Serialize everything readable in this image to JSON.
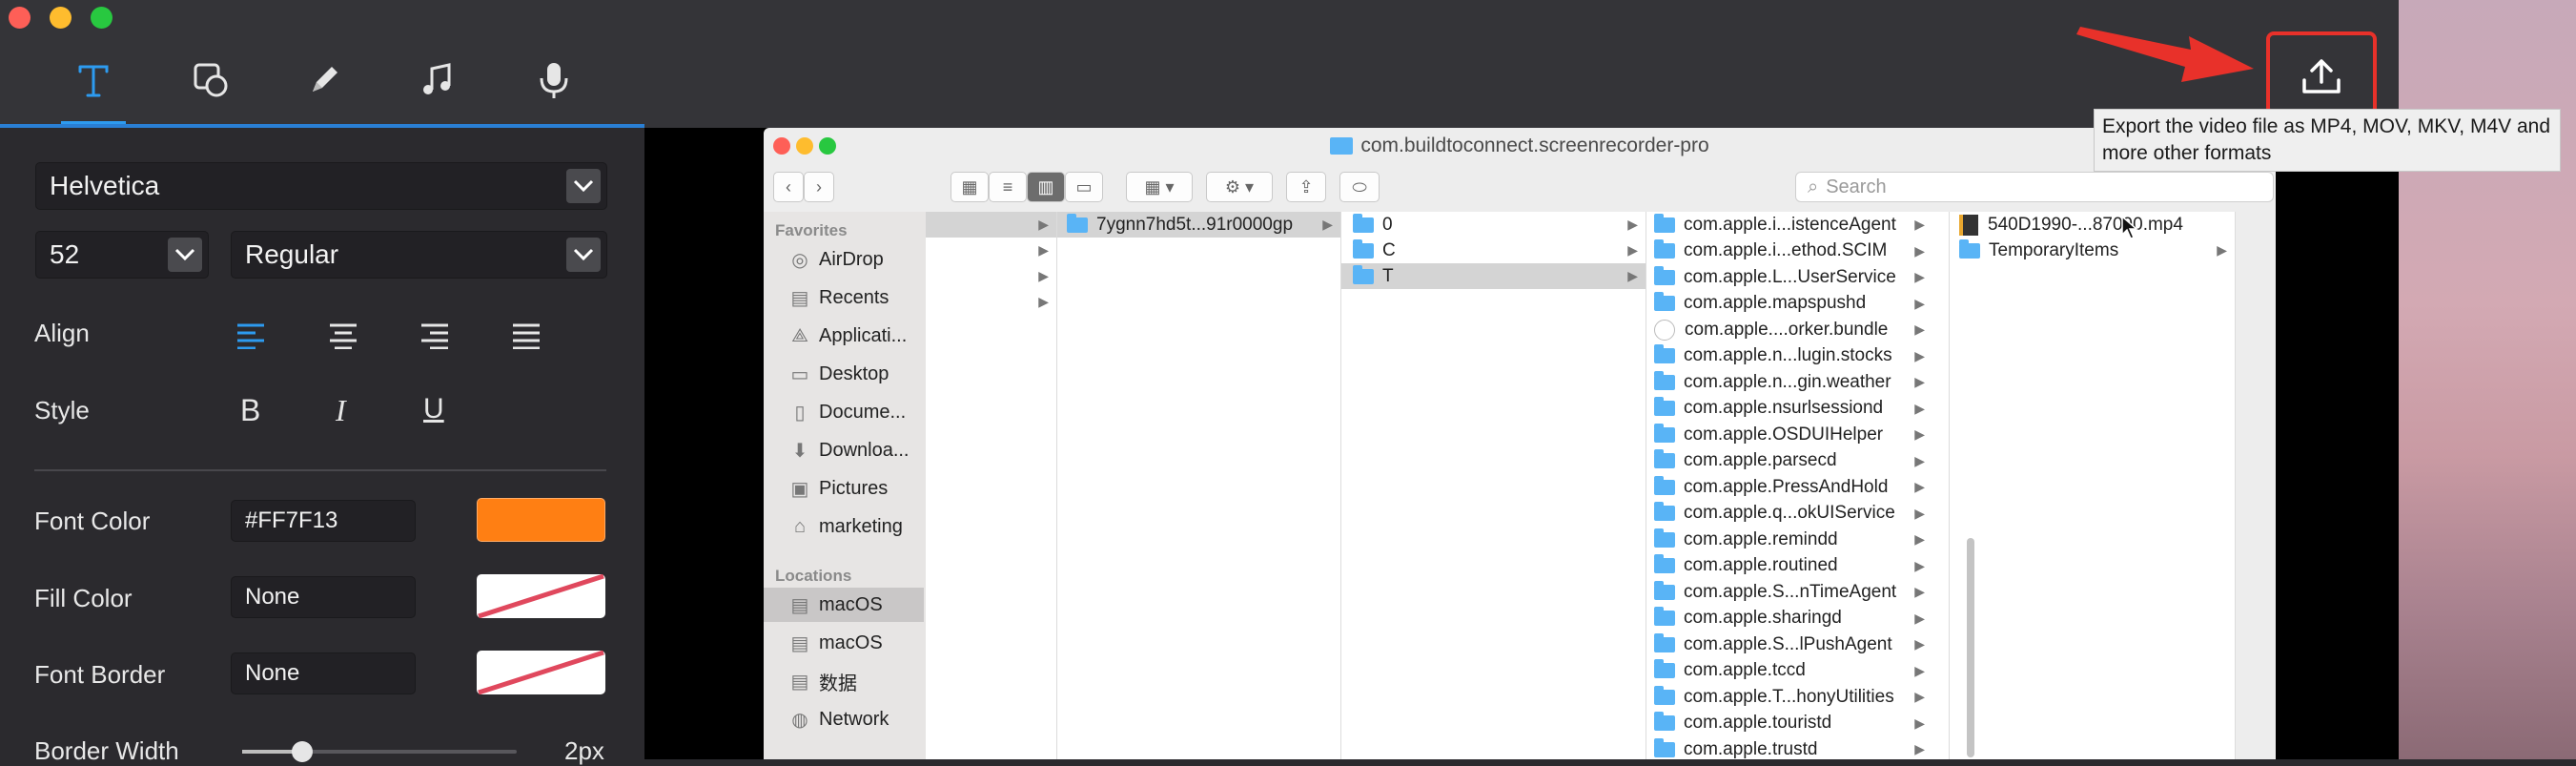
{
  "toolbar": {
    "tools": [
      "text-tool",
      "shape-tool",
      "pen-tool",
      "music-tool",
      "microphone-tool"
    ]
  },
  "panel": {
    "font_family": "Helvetica",
    "font_size": "52",
    "font_weight": "Regular",
    "align_label": "Align",
    "style_label": "Style",
    "style_bold": "B",
    "style_italic": "I",
    "style_underline": "U",
    "font_color_label": "Font Color",
    "font_color_value": "#FF7F13",
    "font_color_hex": "#FF7F13",
    "fill_color_label": "Fill Color",
    "fill_color_value": "None",
    "font_border_label": "Font Border",
    "font_border_value": "None",
    "border_width_label": "Border Width",
    "border_width_value": "2px"
  },
  "finder": {
    "title": "com.buildtoconnect.screenrecorder-pro",
    "search_placeholder": "Search",
    "favorites_header": "Favorites",
    "favorites": [
      {
        "label": "AirDrop",
        "icon": "airdrop-icon"
      },
      {
        "label": "Recents",
        "icon": "recents-icon"
      },
      {
        "label": "Applicati...",
        "icon": "applications-icon"
      },
      {
        "label": "Desktop",
        "icon": "desktop-icon"
      },
      {
        "label": "Docume...",
        "icon": "documents-icon"
      },
      {
        "label": "Downloa...",
        "icon": "downloads-icon"
      },
      {
        "label": "Pictures",
        "icon": "pictures-icon"
      },
      {
        "label": "marketing",
        "icon": "home-icon"
      }
    ],
    "locations_header": "Locations",
    "locations": [
      {
        "label": "macOS",
        "icon": "disk-icon"
      },
      {
        "label": "macOS",
        "icon": "disk-icon"
      },
      {
        "label": "数据",
        "icon": "disk-icon"
      },
      {
        "label": "Network",
        "icon": "network-icon"
      }
    ],
    "col2": [
      "7ygnn7hd5t...91r0000gp"
    ],
    "col3": [
      "0",
      "C",
      "T"
    ],
    "col4": [
      "com.apple.i...istenceAgent",
      "com.apple.i...ethod.SCIM",
      "com.apple.L...UserService",
      "com.apple.mapspushd",
      "com.apple....orker.bundle",
      "com.apple.n...lugin.stocks",
      "com.apple.n...gin.weather",
      "com.apple.nsurlsessiond",
      "com.apple.OSDUIHelper",
      "com.apple.parsecd",
      "com.apple.PressAndHold",
      "com.apple.q...okUIService",
      "com.apple.remindd",
      "com.apple.routined",
      "com.apple.S...nTimeAgent",
      "com.apple.sharingd",
      "com.apple.S...lPushAgent",
      "com.apple.tccd",
      "com.apple.T...honyUtilities",
      "com.apple.touristd",
      "com.apple.trustd"
    ],
    "col5": [
      "540D1990-...87090.mp4",
      "TemporaryItems"
    ]
  },
  "tooltip": {
    "text": "Export the video file as MP4, MOV, MKV, M4V and more other formats"
  },
  "colors": {
    "accent": "#2d9bf0",
    "font_color": "#FF7F13",
    "highlight": "#e8312a"
  }
}
